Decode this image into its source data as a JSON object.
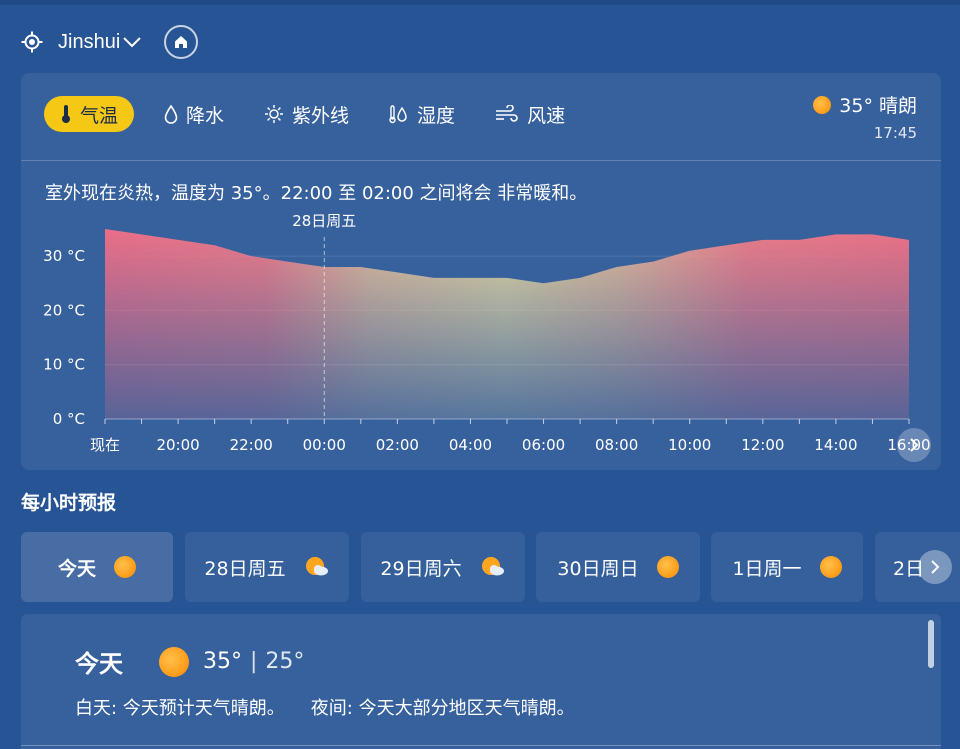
{
  "location": {
    "city": "Jinshui"
  },
  "tabs": [
    {
      "label": "气温",
      "icon": "thermometer-icon",
      "active": true
    },
    {
      "label": "降水",
      "icon": "drop-icon",
      "active": false
    },
    {
      "label": "紫外线",
      "icon": "sun-rays-icon",
      "active": false
    },
    {
      "label": "湿度",
      "icon": "humidity-icon",
      "active": false
    },
    {
      "label": "风速",
      "icon": "wind-icon",
      "active": false
    }
  ],
  "current": {
    "temp_condition": "35° 晴朗",
    "time": "17:45",
    "icon": "sun-icon"
  },
  "summary": "室外现在炎热，温度为 35°。22:00 至 02:00 之间将会 非常暖和。",
  "chart_data": {
    "type": "area",
    "x": [
      "现在",
      "19:00",
      "20:00",
      "21:00",
      "22:00",
      "23:00",
      "00:00",
      "01:00",
      "02:00",
      "03:00",
      "04:00",
      "05:00",
      "06:00",
      "07:00",
      "08:00",
      "09:00",
      "10:00",
      "11:00",
      "12:00",
      "13:00",
      "14:00",
      "15:00",
      "16:00"
    ],
    "x_tick_labels": [
      "现在",
      "20:00",
      "22:00",
      "00:00",
      "02:00",
      "04:00",
      "06:00",
      "08:00",
      "10:00",
      "12:00",
      "14:00",
      "16:00"
    ],
    "values": [
      35,
      34,
      33,
      32,
      30,
      29,
      28,
      28,
      27,
      26,
      26,
      26,
      25,
      26,
      28,
      29,
      31,
      32,
      33,
      33,
      34,
      34,
      33
    ],
    "y_ticks": [
      "0 °C",
      "10 °C",
      "20 °C",
      "30 °C"
    ],
    "ylim": [
      0,
      35
    ],
    "marker_label": "28日周五",
    "marker_at": "00:00",
    "grid": true
  },
  "hourly_title": "每小时预报",
  "days": [
    {
      "label": "今天",
      "icon": "sun-icon",
      "active": true
    },
    {
      "label": "28日周五",
      "icon": "partly-cloudy-icon",
      "active": false
    },
    {
      "label": "29日周六",
      "icon": "partly-cloudy-icon",
      "active": false
    },
    {
      "label": "30日周日",
      "icon": "sun-icon",
      "active": false
    },
    {
      "label": "1日周一",
      "icon": "sun-icon",
      "active": false
    },
    {
      "label": "2日",
      "icon": "sun-icon",
      "active": false
    }
  ],
  "detail": {
    "day": "今天",
    "high": "35°",
    "separator": "|",
    "low": "25°",
    "daytime": "白天: 今天预计天气晴朗。",
    "night": "夜间: 今天大部分地区天气晴朗。"
  }
}
